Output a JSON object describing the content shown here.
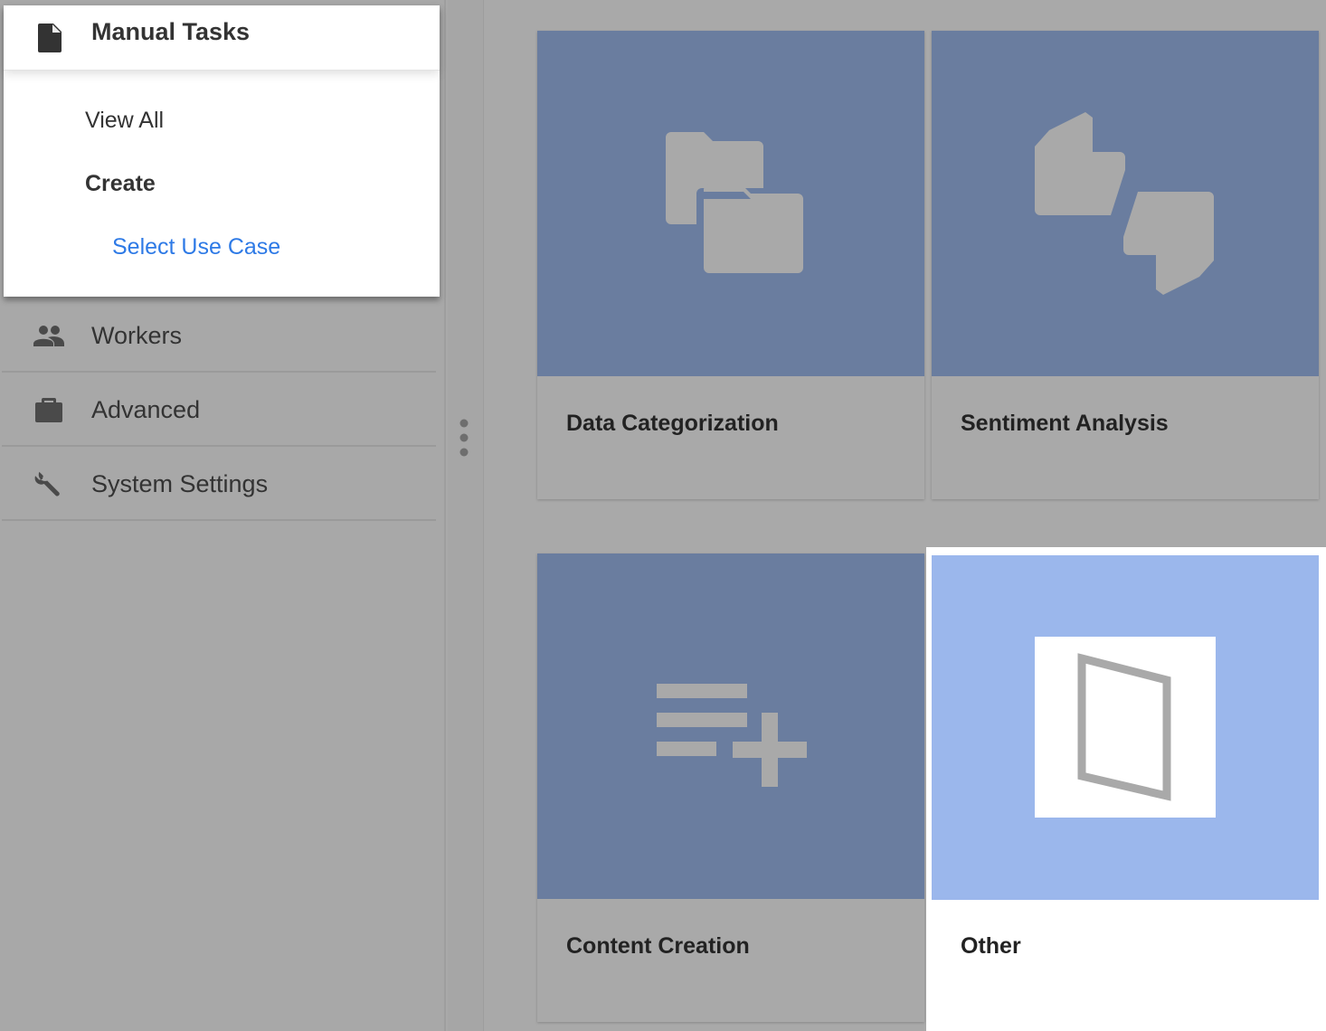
{
  "sidebar": {
    "group": {
      "title": "Manual Tasks",
      "icon": "document-icon",
      "items": [
        {
          "label": "View All"
        },
        {
          "label": "Create"
        },
        {
          "label": "Select Use Case"
        }
      ]
    },
    "nav": [
      {
        "label": "Workers",
        "icon": "people-icon"
      },
      {
        "label": "Advanced",
        "icon": "briefcase-icon"
      },
      {
        "label": "System Settings",
        "icon": "wrench-icon"
      }
    ]
  },
  "splitter": {
    "icon": "more-vertical-icon"
  },
  "cards": [
    {
      "label": "Data Categorization",
      "icon": "folders-icon"
    },
    {
      "label": "Sentiment Analysis",
      "icon": "thumbs-up-down-icon"
    },
    {
      "label": "Content Creation",
      "icon": "playlist-add-icon"
    },
    {
      "label": "Other",
      "icon": "placeholder-image-icon",
      "selected": true
    }
  ],
  "colors": {
    "link": "#2e7ae6",
    "card_media": "#6a7d9f",
    "card_media_selected": "#9bb7ec",
    "overlay": "#a9a9a9"
  }
}
